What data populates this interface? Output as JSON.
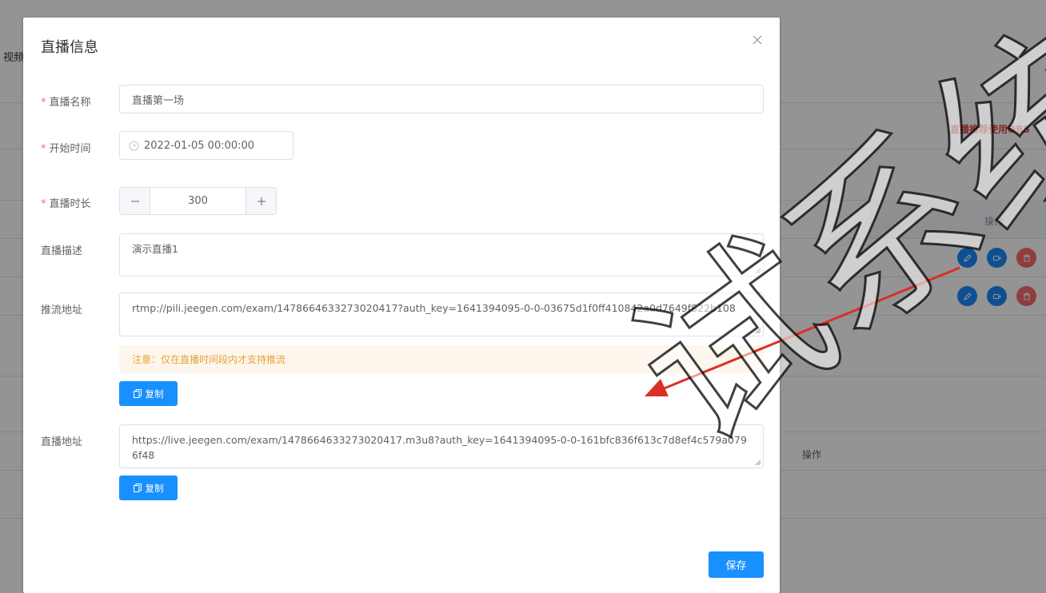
{
  "background": {
    "side_text": "视频",
    "obs_notice": "直播推荐使用OBS",
    "table_header_action": "操作",
    "second_header_action": "操作"
  },
  "dialog": {
    "title": "直播信息",
    "fields": {
      "name_label": "直播名称",
      "name_value": "直播第一场",
      "start_label": "开始时间",
      "start_value": "2022-01-05 00:00:00",
      "duration_label": "直播时长",
      "duration_value": "300",
      "desc_label": "直播描述",
      "desc_value": "演示直播1",
      "push_label": "推流地址",
      "push_value": "rtmp://pili.jeegen.com/exam/1478664633273020417?auth_key=1641394095-0-0-03675d1f0ff410842a0d7649f822b108",
      "play_label": "直播地址",
      "play_value": "https://live.jeegen.com/exam/1478664633273020417.m3u8?auth_key=1641394095-0-0-161bfc836f613c7d8ef4c579a0796f48"
    },
    "notice_text": "注意：仅在直播时间段内才支持推流",
    "copy_label": "复制",
    "save_label": "保存"
  },
  "watermark_text": "试系统",
  "colors": {
    "primary": "#1890ff",
    "danger": "#f56c6c",
    "warning_text": "#e6a23c",
    "warning_bg": "#fdf6ec",
    "arrow": "#d93025"
  }
}
